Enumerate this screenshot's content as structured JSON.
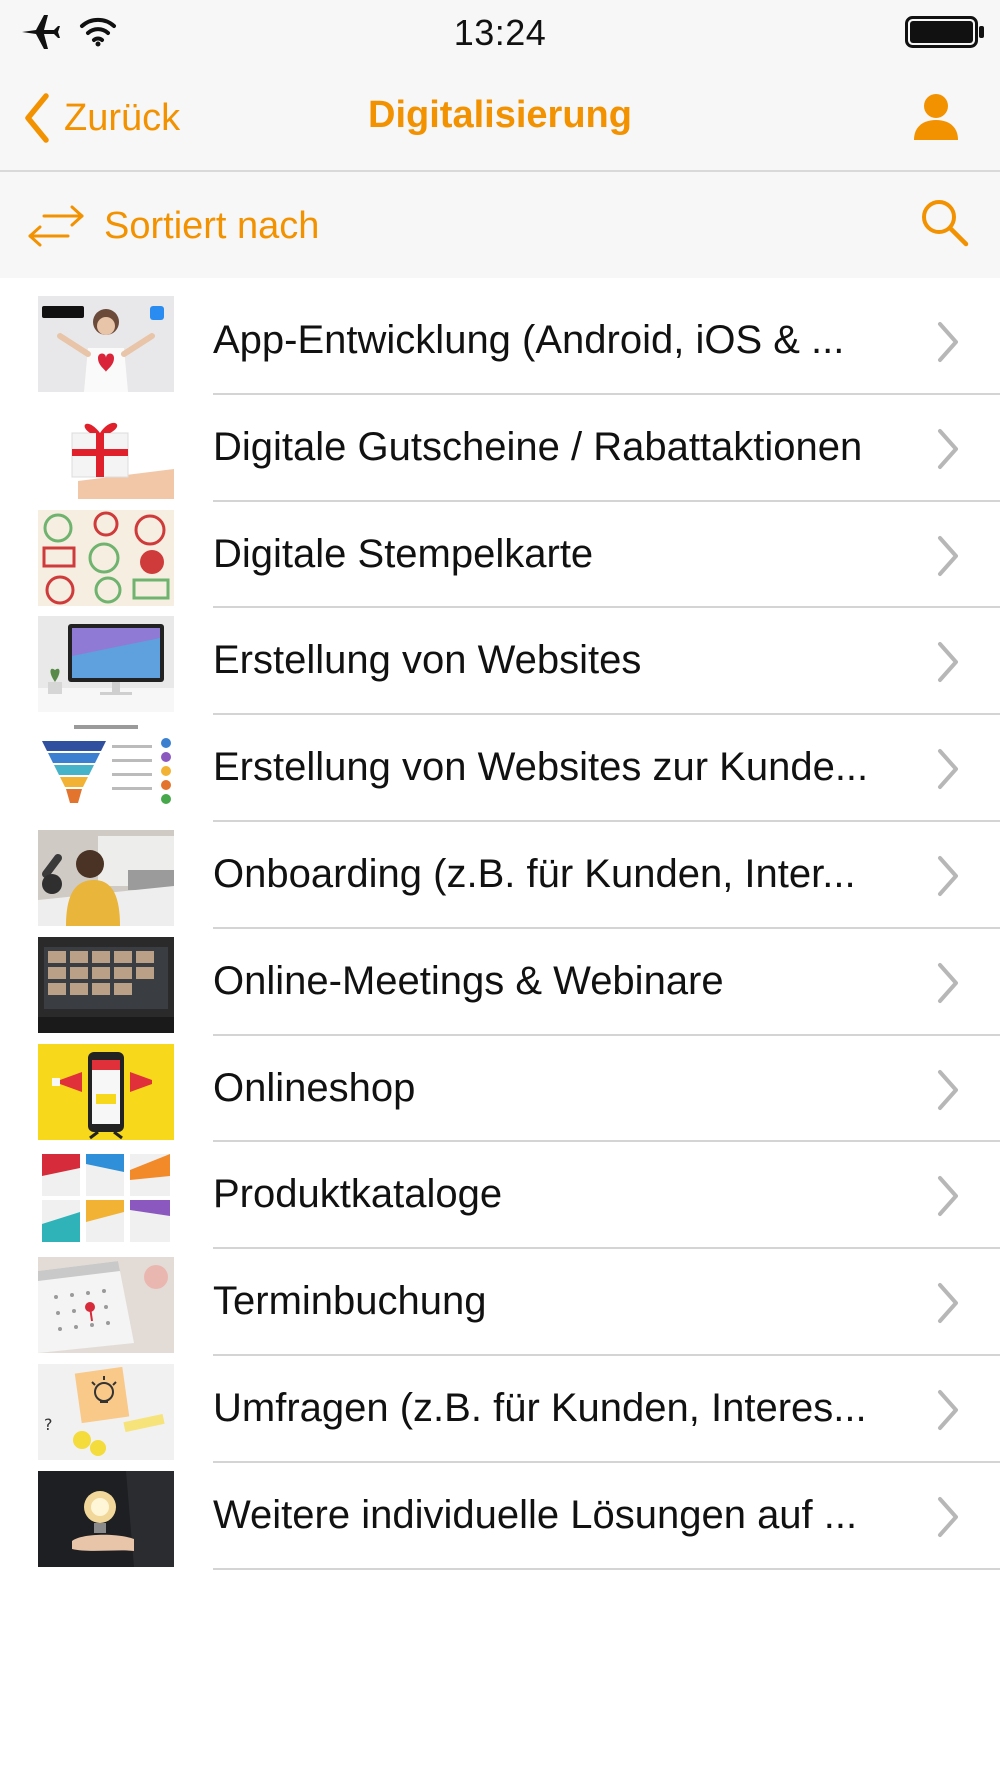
{
  "status_bar": {
    "time": "13:24",
    "icons": [
      "airplane-icon",
      "wifi-icon",
      "battery-icon"
    ]
  },
  "nav": {
    "back_label": "Zurück",
    "title": "Digitalisierung",
    "accent_color": "#f39200"
  },
  "sort": {
    "label": "Sortiert nach"
  },
  "list": {
    "items": [
      {
        "label": "App-Entwicklung (Android, iOS & ..."
      },
      {
        "label": "Digitale Gutscheine / Rabattaktionen"
      },
      {
        "label": "Digitale Stempelkarte"
      },
      {
        "label": "Erstellung von Websites"
      },
      {
        "label": "Erstellung von Websites zur Kunde..."
      },
      {
        "label": "Onboarding (z.B. für Kunden, Inter..."
      },
      {
        "label": "Online-Meetings & Webinare"
      },
      {
        "label": "Onlineshop"
      },
      {
        "label": "Produktkataloge"
      },
      {
        "label": "Terminbuchung"
      },
      {
        "label": "Umfragen (z.B. für Kunden, Interes..."
      },
      {
        "label": "Weitere individuelle Lösungen auf ..."
      }
    ]
  }
}
